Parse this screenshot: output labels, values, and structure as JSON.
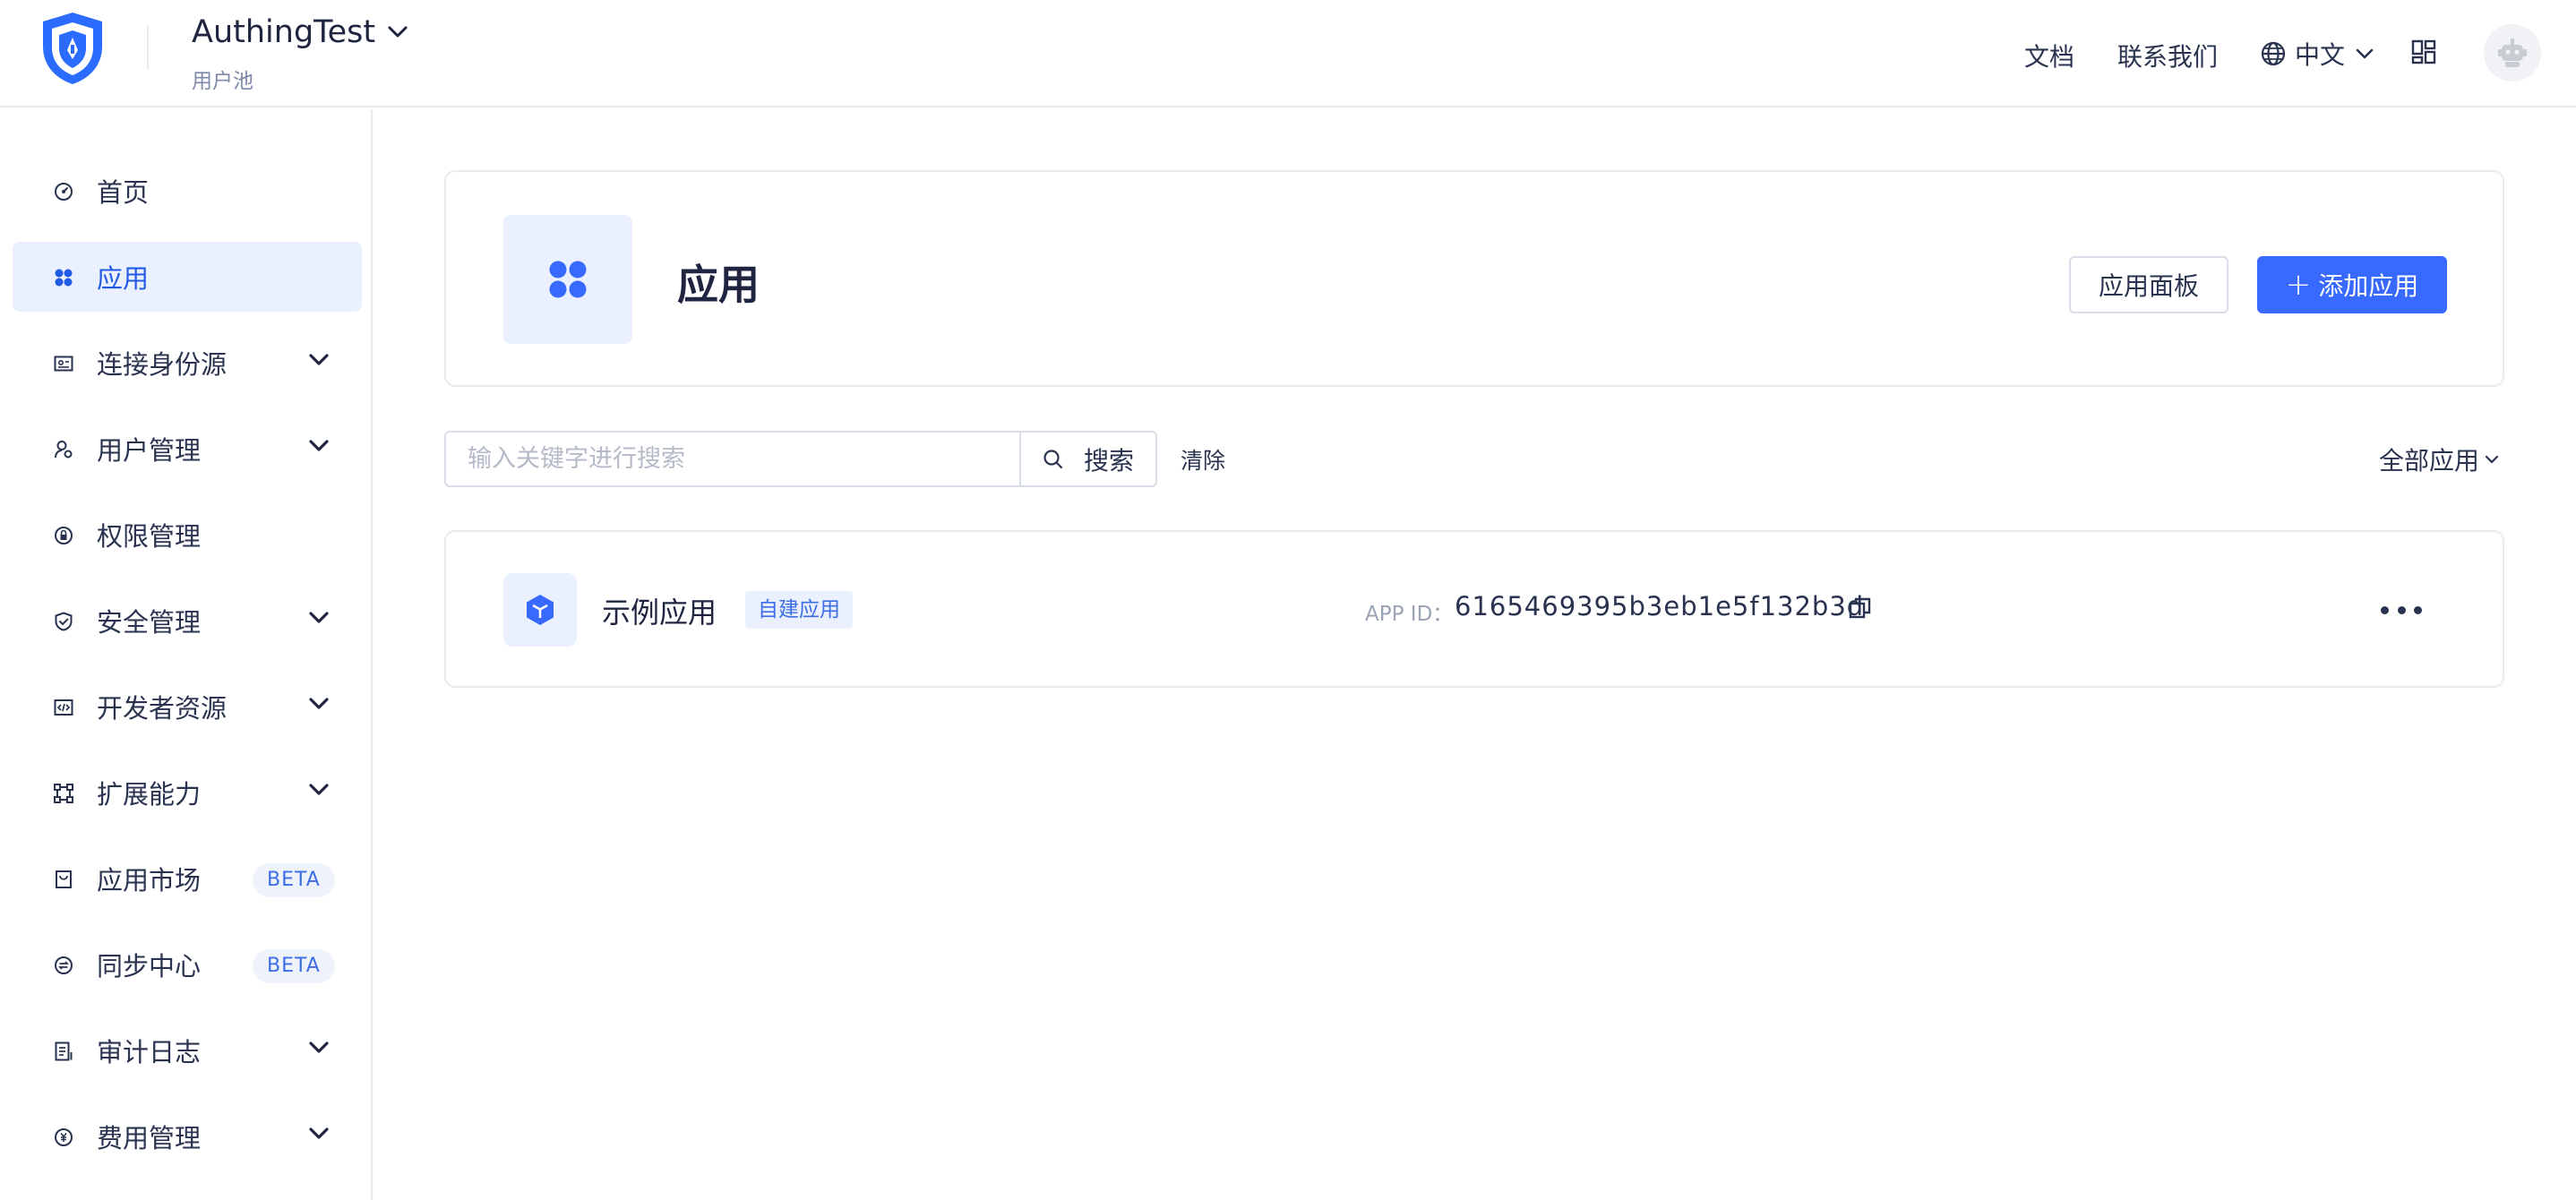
{
  "header": {
    "pool_name": "AuthingTest",
    "pool_subtitle": "用户池",
    "docs_link": "文档",
    "contact_link": "联系我们",
    "language": "中文",
    "brand_color": "#2b6cff"
  },
  "sidebar": {
    "items": [
      {
        "label": "首页",
        "icon": "dashboard-icon",
        "has_chevron": false
      },
      {
        "label": "应用",
        "icon": "apps-icon",
        "has_chevron": false,
        "active": true
      },
      {
        "label": "连接身份源",
        "icon": "id-card-icon",
        "has_chevron": true
      },
      {
        "label": "用户管理",
        "icon": "user-settings-icon",
        "has_chevron": true
      },
      {
        "label": "权限管理",
        "icon": "lock-icon",
        "has_chevron": false
      },
      {
        "label": "安全管理",
        "icon": "shield-check-icon",
        "has_chevron": true
      },
      {
        "label": "开发者资源",
        "icon": "code-icon",
        "has_chevron": true
      },
      {
        "label": "扩展能力",
        "icon": "extension-icon",
        "has_chevron": true
      },
      {
        "label": "应用市场",
        "icon": "store-icon",
        "badge": "BETA"
      },
      {
        "label": "同步中心",
        "icon": "sync-icon",
        "badge": "BETA"
      },
      {
        "label": "审计日志",
        "icon": "log-icon",
        "has_chevron": true
      },
      {
        "label": "费用管理",
        "icon": "billing-icon",
        "has_chevron": true
      }
    ]
  },
  "main": {
    "title": "应用",
    "panel_button": "应用面板",
    "add_button": "添加应用",
    "add_button_plus": "+",
    "search": {
      "placeholder": "输入关键字进行搜索",
      "button": "搜索",
      "clear": "清除"
    },
    "filter": "全部应用",
    "apps": [
      {
        "name": "示例应用",
        "tag": "自建应用",
        "app_id_label": "APP ID：",
        "app_id": "6165469395b3eb1e5f132b3d"
      }
    ]
  },
  "colors": {
    "primary": "#396aff",
    "active_bg": "#eaf0fd",
    "active_text": "#215ae5",
    "text": "#293350"
  }
}
